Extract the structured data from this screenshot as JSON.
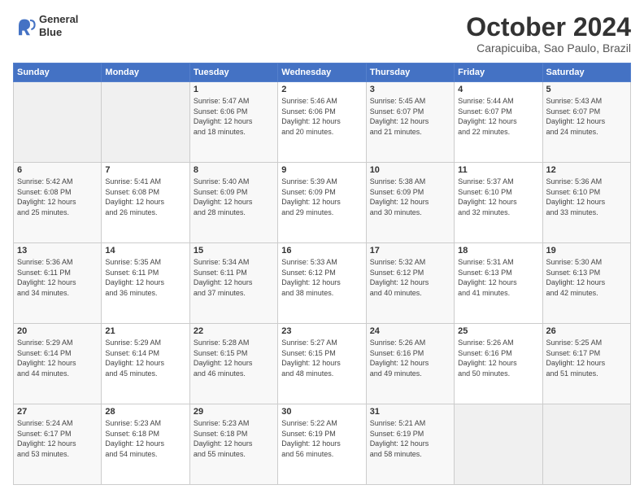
{
  "header": {
    "logo_line1": "General",
    "logo_line2": "Blue",
    "month": "October 2024",
    "location": "Carapicuiba, Sao Paulo, Brazil"
  },
  "days_of_week": [
    "Sunday",
    "Monday",
    "Tuesday",
    "Wednesday",
    "Thursday",
    "Friday",
    "Saturday"
  ],
  "weeks": [
    [
      {
        "day": "",
        "info": ""
      },
      {
        "day": "",
        "info": ""
      },
      {
        "day": "1",
        "info": "Sunrise: 5:47 AM\nSunset: 6:06 PM\nDaylight: 12 hours\nand 18 minutes."
      },
      {
        "day": "2",
        "info": "Sunrise: 5:46 AM\nSunset: 6:06 PM\nDaylight: 12 hours\nand 20 minutes."
      },
      {
        "day": "3",
        "info": "Sunrise: 5:45 AM\nSunset: 6:07 PM\nDaylight: 12 hours\nand 21 minutes."
      },
      {
        "day": "4",
        "info": "Sunrise: 5:44 AM\nSunset: 6:07 PM\nDaylight: 12 hours\nand 22 minutes."
      },
      {
        "day": "5",
        "info": "Sunrise: 5:43 AM\nSunset: 6:07 PM\nDaylight: 12 hours\nand 24 minutes."
      }
    ],
    [
      {
        "day": "6",
        "info": "Sunrise: 5:42 AM\nSunset: 6:08 PM\nDaylight: 12 hours\nand 25 minutes."
      },
      {
        "day": "7",
        "info": "Sunrise: 5:41 AM\nSunset: 6:08 PM\nDaylight: 12 hours\nand 26 minutes."
      },
      {
        "day": "8",
        "info": "Sunrise: 5:40 AM\nSunset: 6:09 PM\nDaylight: 12 hours\nand 28 minutes."
      },
      {
        "day": "9",
        "info": "Sunrise: 5:39 AM\nSunset: 6:09 PM\nDaylight: 12 hours\nand 29 minutes."
      },
      {
        "day": "10",
        "info": "Sunrise: 5:38 AM\nSunset: 6:09 PM\nDaylight: 12 hours\nand 30 minutes."
      },
      {
        "day": "11",
        "info": "Sunrise: 5:37 AM\nSunset: 6:10 PM\nDaylight: 12 hours\nand 32 minutes."
      },
      {
        "day": "12",
        "info": "Sunrise: 5:36 AM\nSunset: 6:10 PM\nDaylight: 12 hours\nand 33 minutes."
      }
    ],
    [
      {
        "day": "13",
        "info": "Sunrise: 5:36 AM\nSunset: 6:11 PM\nDaylight: 12 hours\nand 34 minutes."
      },
      {
        "day": "14",
        "info": "Sunrise: 5:35 AM\nSunset: 6:11 PM\nDaylight: 12 hours\nand 36 minutes."
      },
      {
        "day": "15",
        "info": "Sunrise: 5:34 AM\nSunset: 6:11 PM\nDaylight: 12 hours\nand 37 minutes."
      },
      {
        "day": "16",
        "info": "Sunrise: 5:33 AM\nSunset: 6:12 PM\nDaylight: 12 hours\nand 38 minutes."
      },
      {
        "day": "17",
        "info": "Sunrise: 5:32 AM\nSunset: 6:12 PM\nDaylight: 12 hours\nand 40 minutes."
      },
      {
        "day": "18",
        "info": "Sunrise: 5:31 AM\nSunset: 6:13 PM\nDaylight: 12 hours\nand 41 minutes."
      },
      {
        "day": "19",
        "info": "Sunrise: 5:30 AM\nSunset: 6:13 PM\nDaylight: 12 hours\nand 42 minutes."
      }
    ],
    [
      {
        "day": "20",
        "info": "Sunrise: 5:29 AM\nSunset: 6:14 PM\nDaylight: 12 hours\nand 44 minutes."
      },
      {
        "day": "21",
        "info": "Sunrise: 5:29 AM\nSunset: 6:14 PM\nDaylight: 12 hours\nand 45 minutes."
      },
      {
        "day": "22",
        "info": "Sunrise: 5:28 AM\nSunset: 6:15 PM\nDaylight: 12 hours\nand 46 minutes."
      },
      {
        "day": "23",
        "info": "Sunrise: 5:27 AM\nSunset: 6:15 PM\nDaylight: 12 hours\nand 48 minutes."
      },
      {
        "day": "24",
        "info": "Sunrise: 5:26 AM\nSunset: 6:16 PM\nDaylight: 12 hours\nand 49 minutes."
      },
      {
        "day": "25",
        "info": "Sunrise: 5:26 AM\nSunset: 6:16 PM\nDaylight: 12 hours\nand 50 minutes."
      },
      {
        "day": "26",
        "info": "Sunrise: 5:25 AM\nSunset: 6:17 PM\nDaylight: 12 hours\nand 51 minutes."
      }
    ],
    [
      {
        "day": "27",
        "info": "Sunrise: 5:24 AM\nSunset: 6:17 PM\nDaylight: 12 hours\nand 53 minutes."
      },
      {
        "day": "28",
        "info": "Sunrise: 5:23 AM\nSunset: 6:18 PM\nDaylight: 12 hours\nand 54 minutes."
      },
      {
        "day": "29",
        "info": "Sunrise: 5:23 AM\nSunset: 6:18 PM\nDaylight: 12 hours\nand 55 minutes."
      },
      {
        "day": "30",
        "info": "Sunrise: 5:22 AM\nSunset: 6:19 PM\nDaylight: 12 hours\nand 56 minutes."
      },
      {
        "day": "31",
        "info": "Sunrise: 5:21 AM\nSunset: 6:19 PM\nDaylight: 12 hours\nand 58 minutes."
      },
      {
        "day": "",
        "info": ""
      },
      {
        "day": "",
        "info": ""
      }
    ]
  ]
}
